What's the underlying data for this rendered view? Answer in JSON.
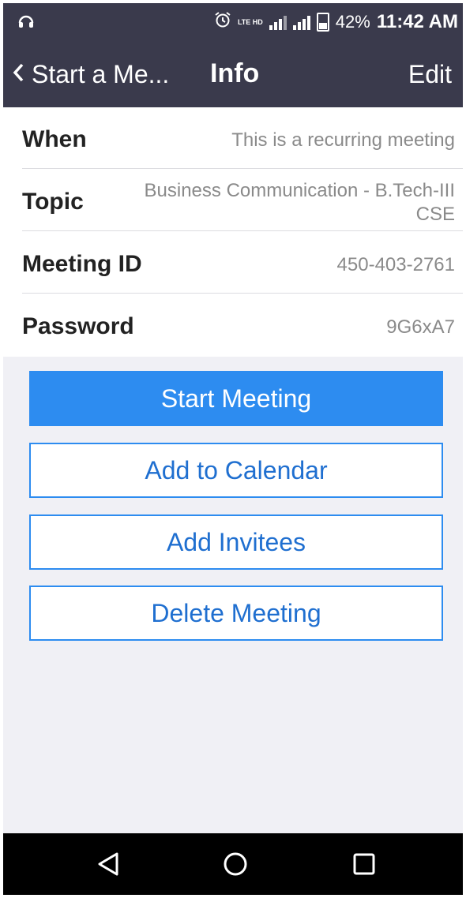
{
  "status_bar": {
    "lte_label": "LTE HD",
    "battery": "42%",
    "time": "11:42 AM",
    "left_icon": "headset-icon",
    "alarm_icon": "alarm-icon"
  },
  "nav": {
    "back_label": "Start a Me...",
    "title": "Info",
    "edit_label": "Edit"
  },
  "info": {
    "when_label": "When",
    "when_value": "This is a recurring meeting",
    "topic_label": "Topic",
    "topic_value_line1": "Business Communication - B.Tech-III",
    "topic_value_line2": "CSE",
    "meeting_id_label": "Meeting ID",
    "meeting_id_value": "450-403-2761",
    "password_label": "Password",
    "password_value": "9G6xA7"
  },
  "actions": {
    "start_meeting": "Start Meeting",
    "add_to_calendar": "Add to Calendar",
    "add_invitees": "Add Invitees",
    "delete_meeting": "Delete Meeting"
  },
  "colors": {
    "header_bg": "#3a3a4c",
    "accent": "#2d8cf0",
    "accent_text": "#1f6fd0"
  },
  "system_nav": {
    "back_icon": "triangle-back-icon",
    "home_icon": "circle-home-icon",
    "recents_icon": "square-recents-icon"
  }
}
